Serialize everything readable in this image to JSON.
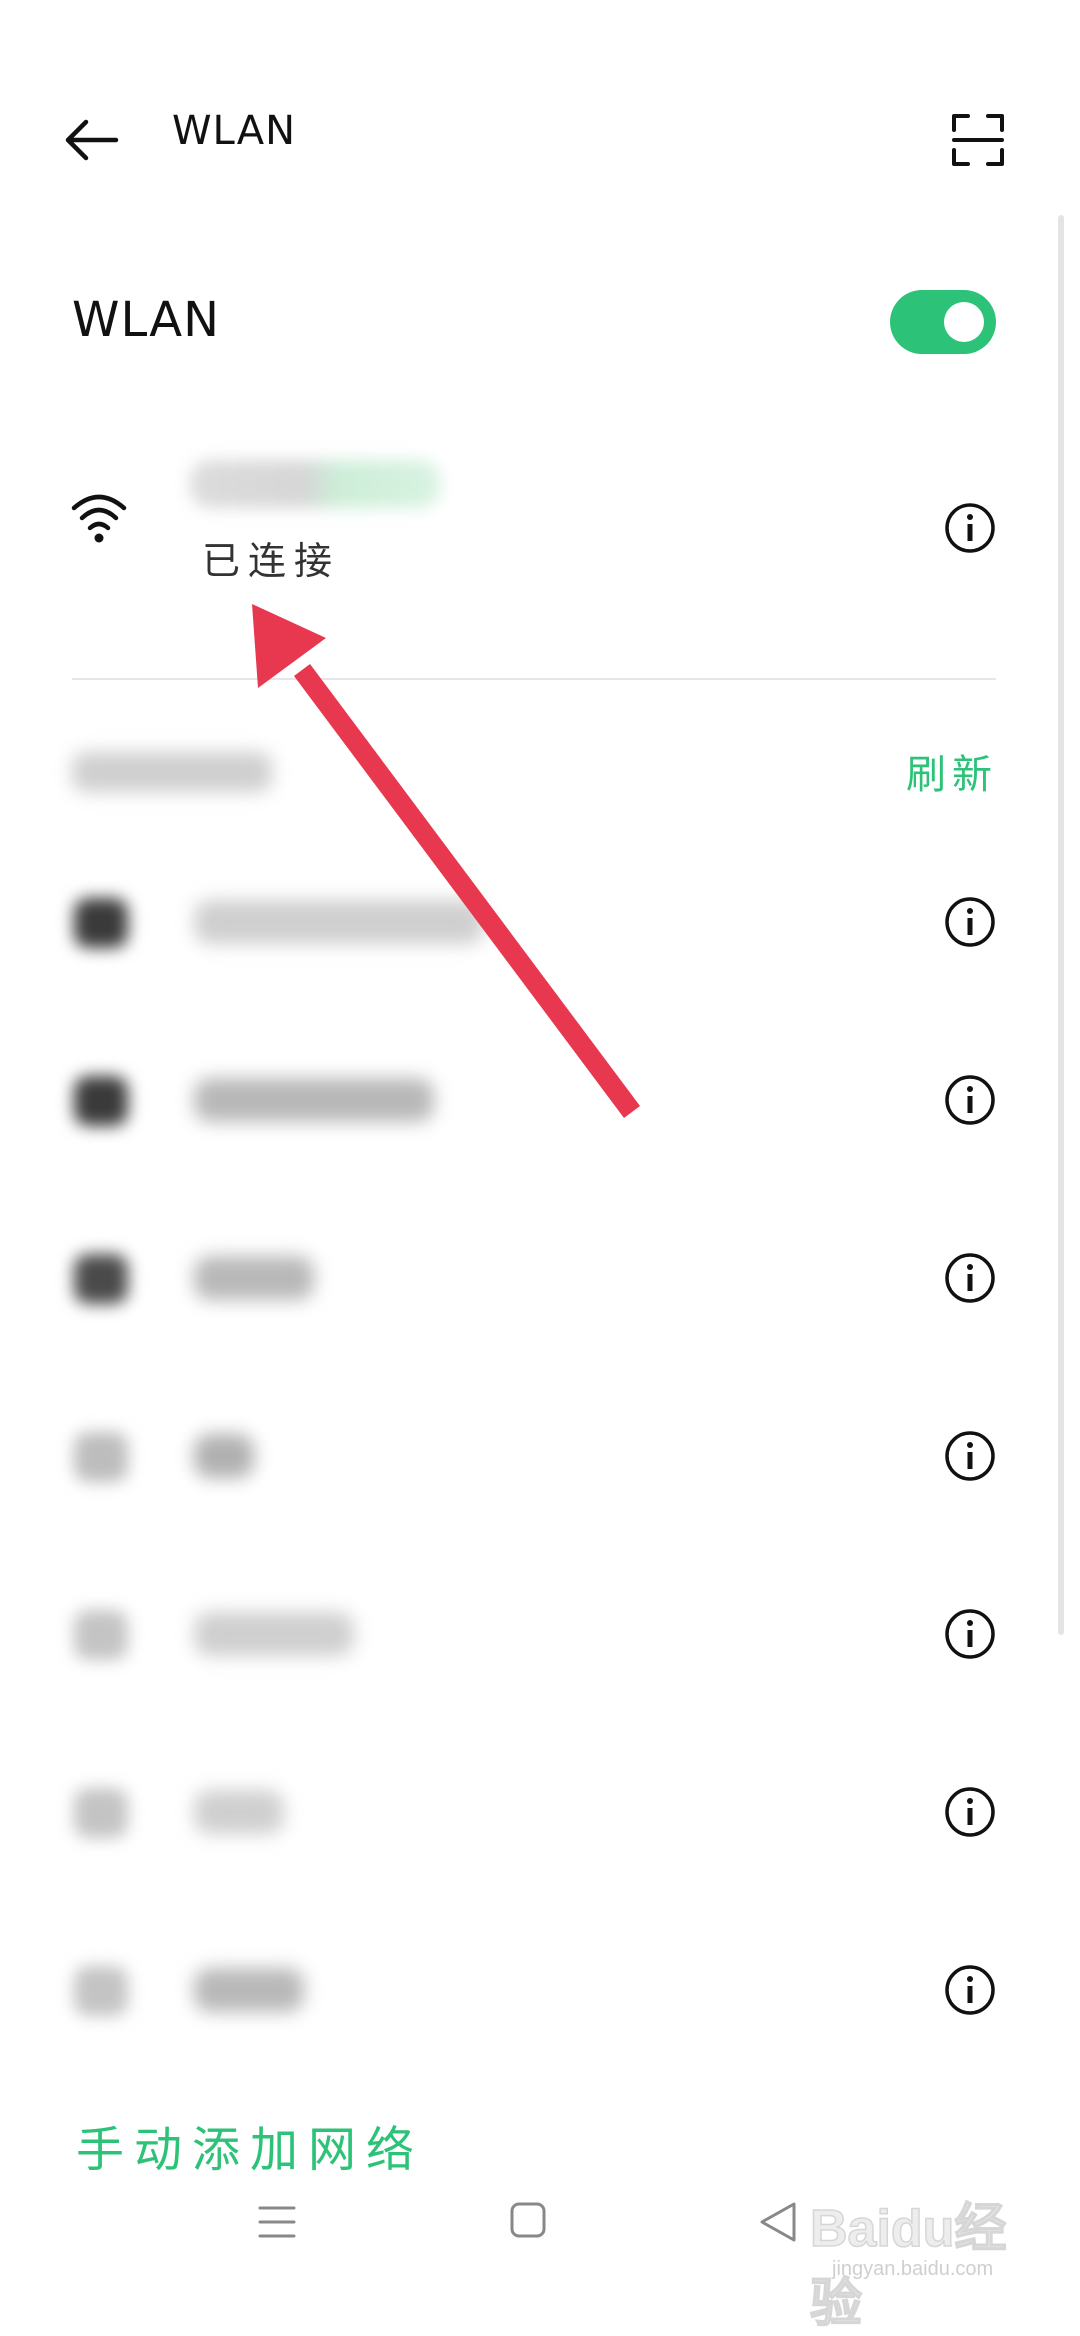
{
  "appbar": {
    "title": "WLAN"
  },
  "wlan": {
    "label": "WLAN",
    "enabled": true
  },
  "connected": {
    "status": "已连接"
  },
  "section": {
    "refresh_label": "刷新"
  },
  "footer": {
    "add_network_label": "手动添加网络"
  },
  "watermark": {
    "logo": "Baidu经验",
    "sub": "jingyan.baidu.com"
  },
  "colors": {
    "accent": "#2cc378",
    "annotation_arrow": "#e8384f",
    "text": "#111111"
  },
  "icons": {
    "back": "arrow-left-icon",
    "scan": "scan-icon",
    "wifi": "wifi-icon",
    "info": "info-circle-icon",
    "nav_menu": "menu-icon",
    "nav_home": "square-icon",
    "nav_back": "triangle-back-icon"
  }
}
